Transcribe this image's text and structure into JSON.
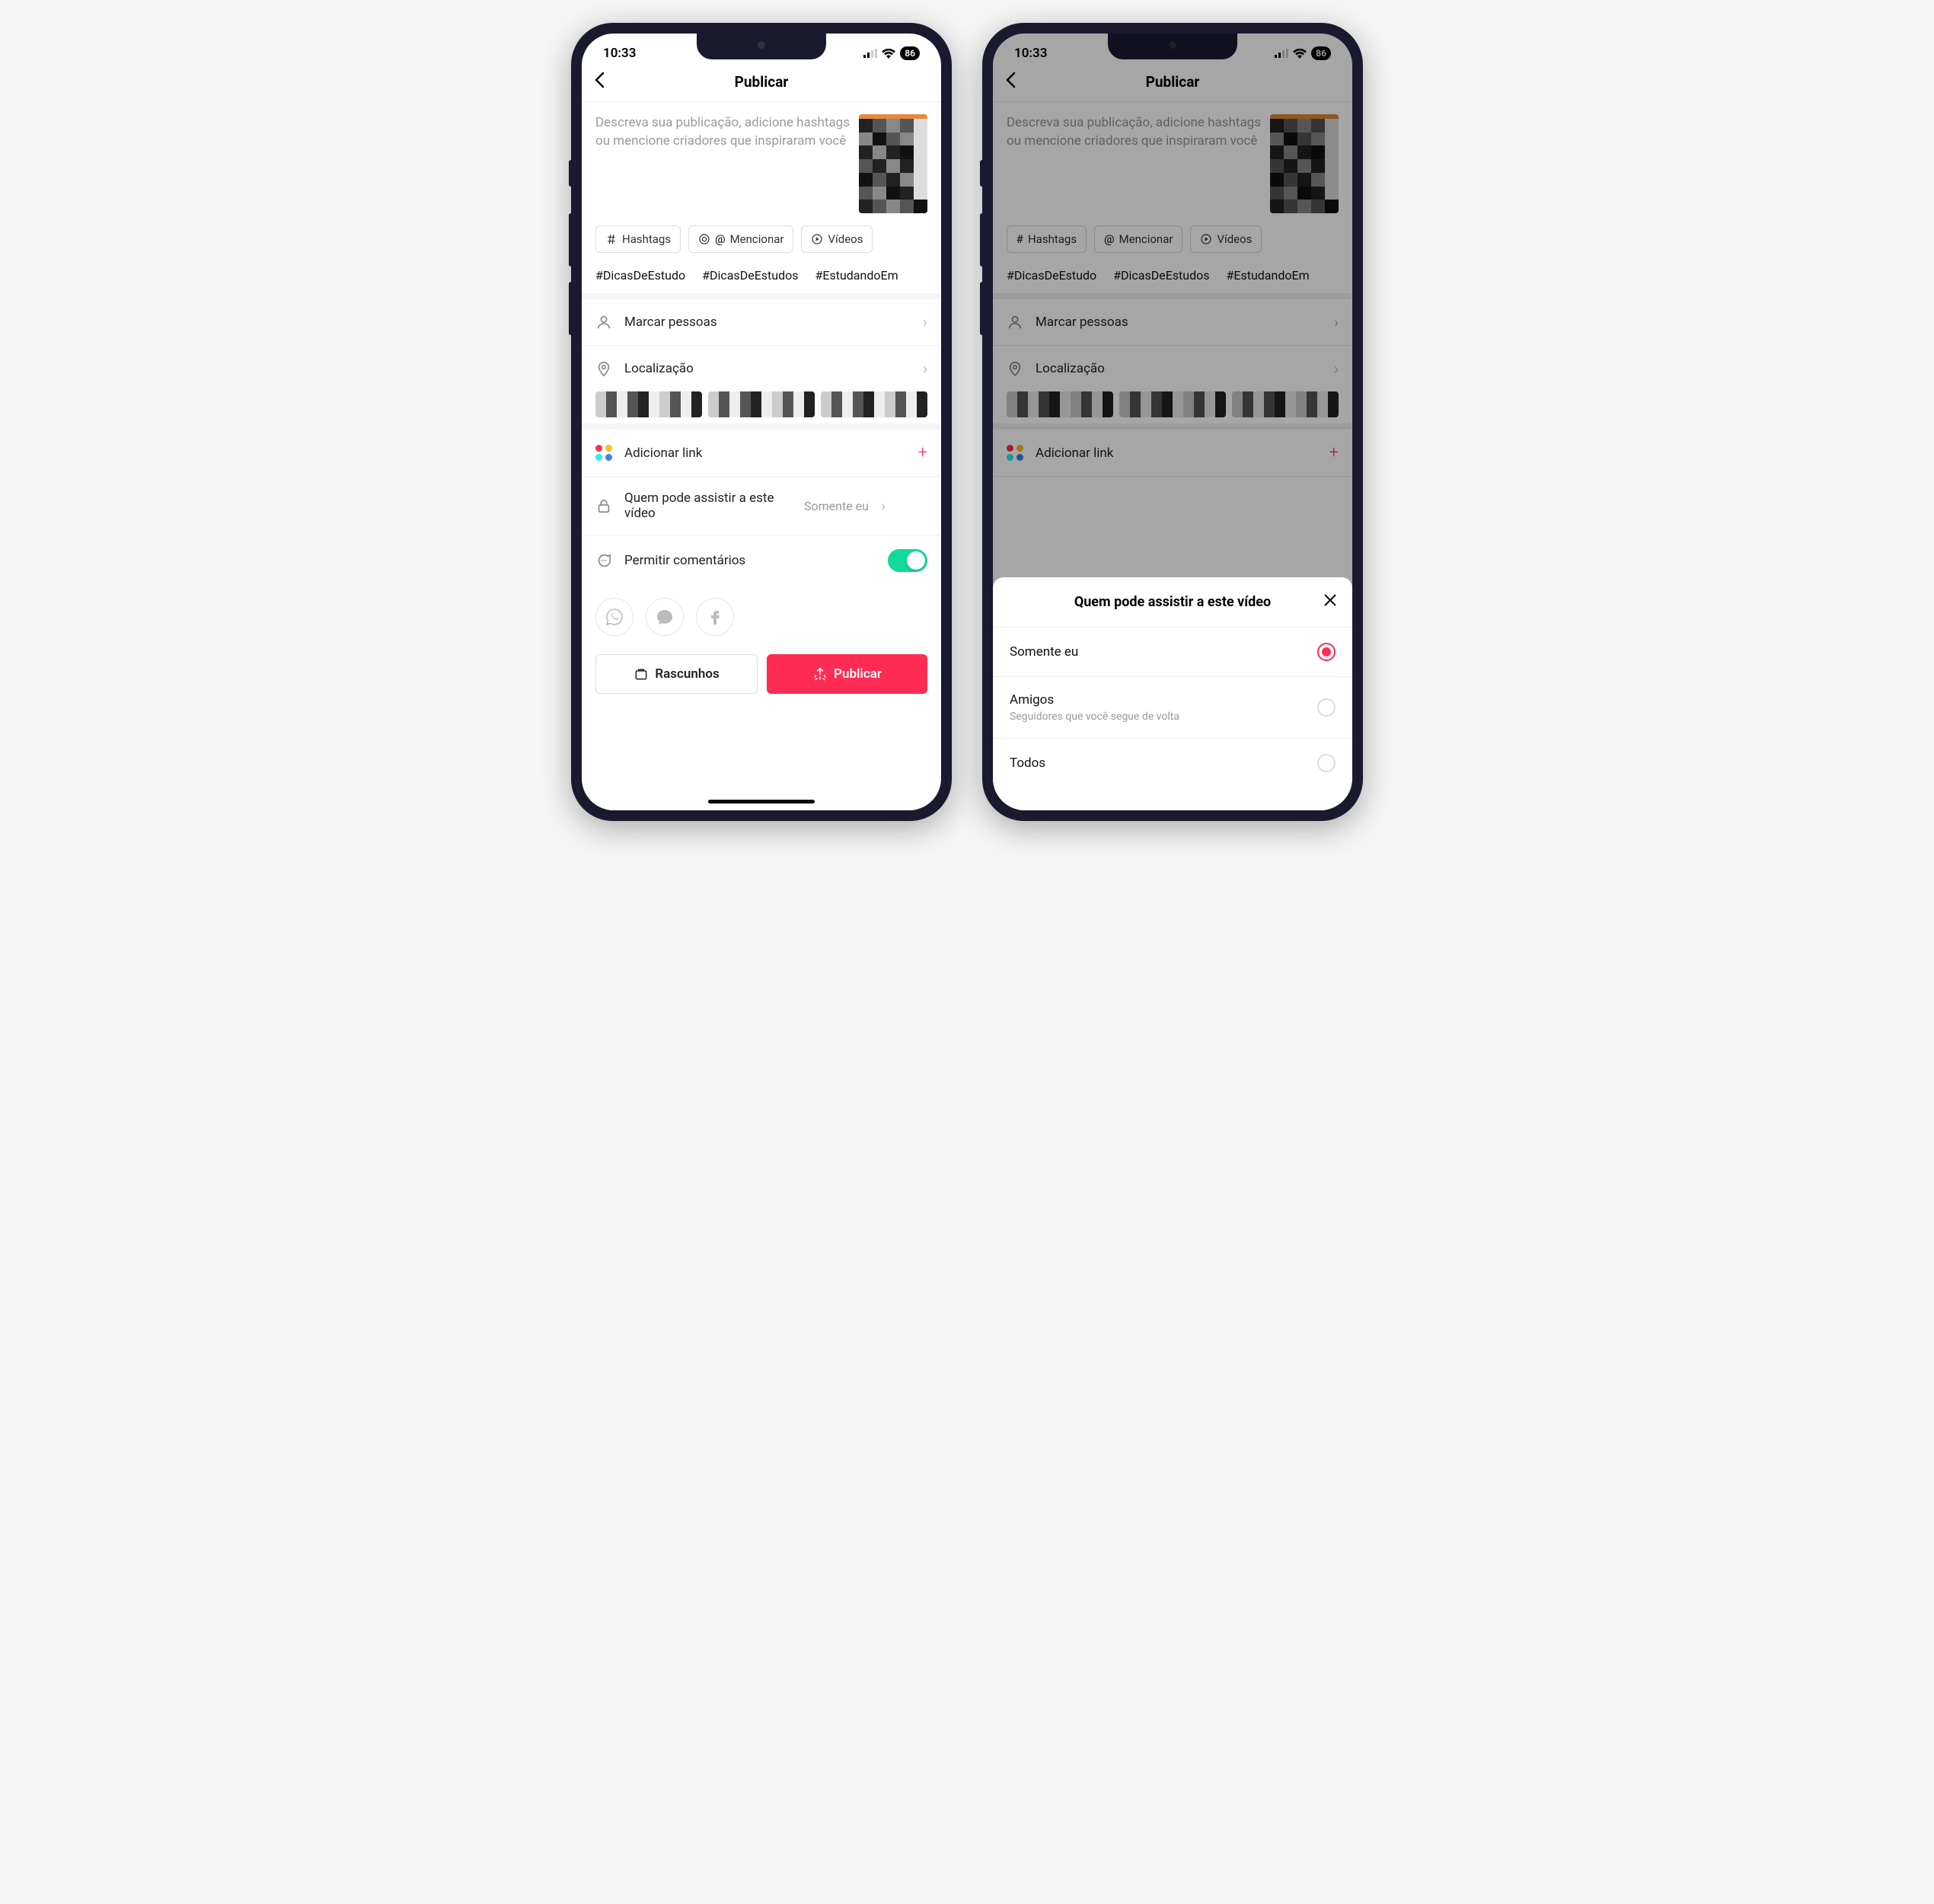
{
  "status": {
    "time": "10:33",
    "battery": "86"
  },
  "nav": {
    "title": "Publicar"
  },
  "compose": {
    "placeholder": "Descreva sua publicação, adicione hashtags ou mencione criadores que inspiraram você"
  },
  "chips": {
    "hashtags": "Hashtags",
    "mention": "Mencionar",
    "videos": "Vídeos"
  },
  "hashtag_suggestions": [
    "#DicasDeEstudo",
    "#DicasDeEstudos",
    "#EstudandoEm"
  ],
  "rows": {
    "tag_people": "Marcar pessoas",
    "location": "Localização",
    "add_link": "Adicionar link",
    "privacy_label": "Quem pode assistir a este vídeo",
    "privacy_value": "Somente eu",
    "comments": "Permitir comentários"
  },
  "actions": {
    "drafts": "Rascunhos",
    "publish": "Publicar"
  },
  "sheet": {
    "title": "Quem pode assistir a este vídeo",
    "options": [
      {
        "title": "Somente eu",
        "sub": "",
        "checked": true
      },
      {
        "title": "Amigos",
        "sub": "Seguidores que você segue de volta",
        "checked": false
      },
      {
        "title": "Todos",
        "sub": "",
        "checked": false
      }
    ]
  }
}
